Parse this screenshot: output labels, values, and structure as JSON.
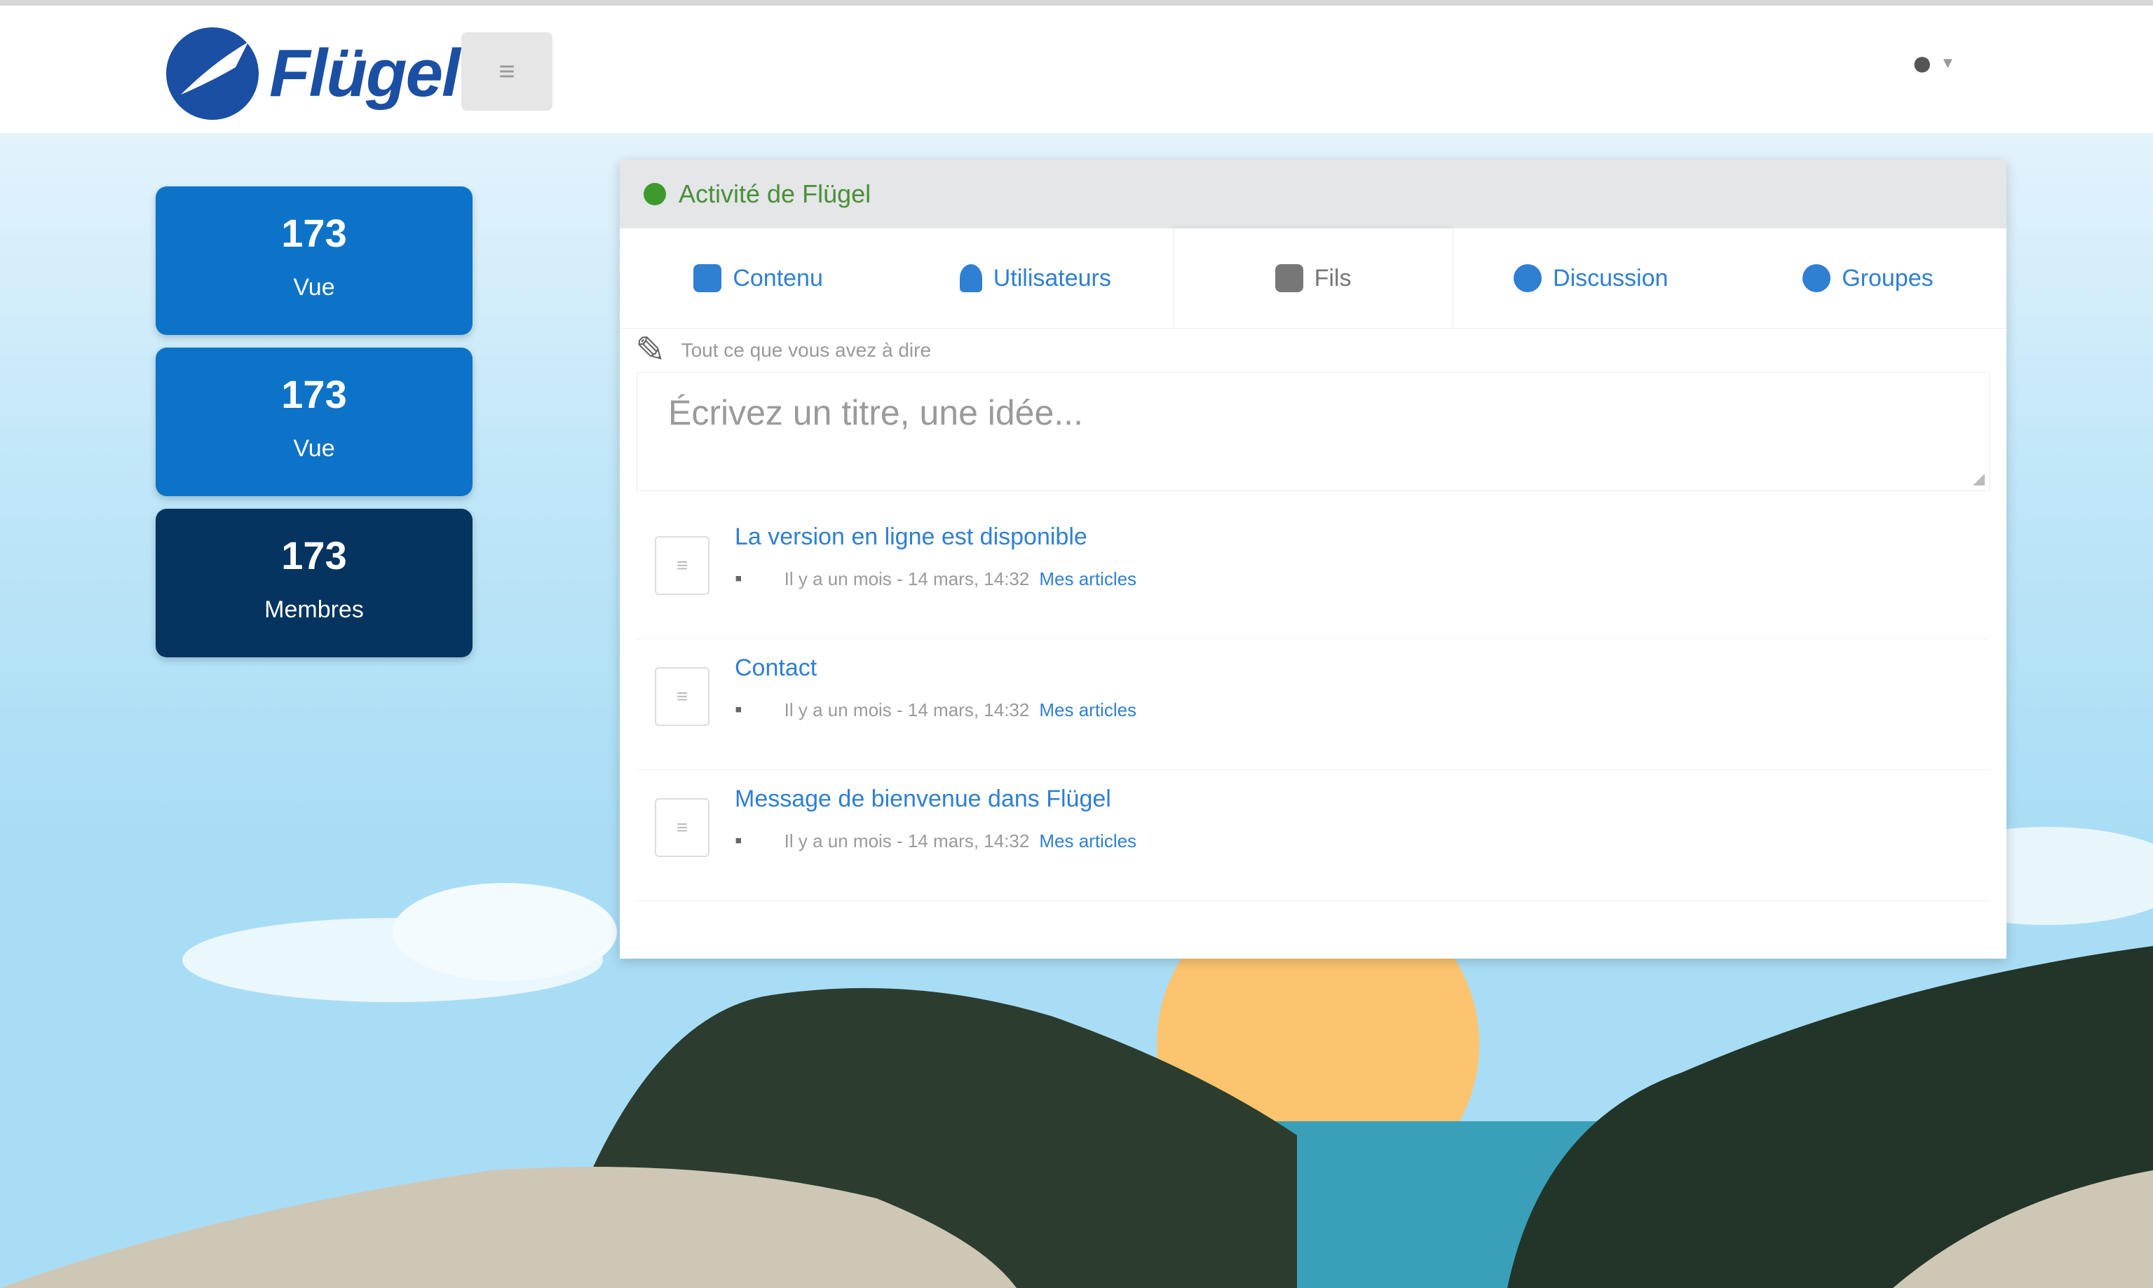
{
  "header": {
    "logo_text": "Flügel",
    "menu_button_label": "",
    "user_icon": "user-icon"
  },
  "stats": [
    {
      "number": "173",
      "label": "Vue"
    },
    {
      "number": "173",
      "label": "Vue"
    },
    {
      "number": "173",
      "label": "Membres"
    }
  ],
  "panel": {
    "title": "Activité de Flügel",
    "tabs": [
      {
        "label": "Contenu",
        "icon": "content-icon"
      },
      {
        "label": "Utilisateurs",
        "icon": "user-icon"
      },
      {
        "label": "Fils",
        "icon": "feed-icon"
      },
      {
        "label": "Discussion",
        "icon": "discussion-icon"
      },
      {
        "label": "Groupes",
        "icon": "group-icon"
      }
    ],
    "hint": "Tout ce que vous avez à dire",
    "compose_placeholder": "Écrivez un titre, une idée...",
    "posts": [
      {
        "title": "La version en ligne est disponible",
        "meta": "Il y a un mois - 14 mars, 14:32",
        "link": "Mes articles"
      },
      {
        "title": "Contact",
        "meta": "Il y a un mois - 14 mars, 14:32",
        "link": "Mes articles"
      },
      {
        "title": "Message de bienvenue dans Flügel",
        "meta": "Il y a un mois - 14 mars, 14:32",
        "link": "Mes articles"
      }
    ]
  },
  "colors": {
    "primary": "#0c73c8",
    "dark": "#04345f",
    "link": "#2f7fd3",
    "panel_header": "#e4e6e7",
    "sky": "#bfe6f8",
    "sun": "#fcc46e",
    "water": "#3aa0ba"
  }
}
